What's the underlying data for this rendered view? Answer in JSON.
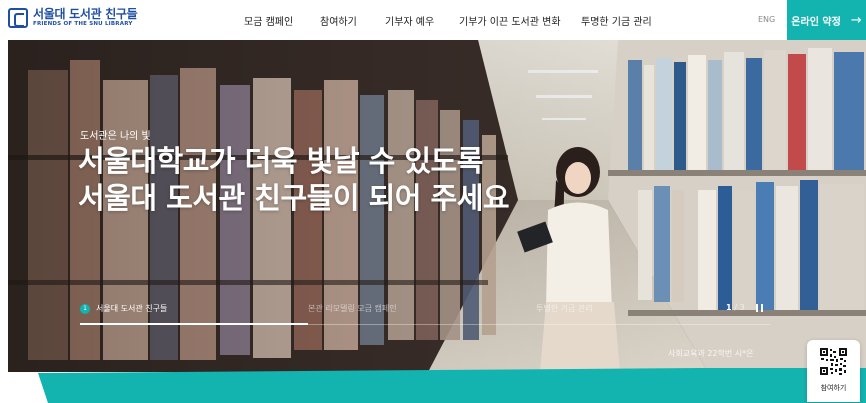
{
  "brand": {
    "title": "서울대 도서관 친구들",
    "subtitle": "FRIENDS OF THE SNU LIBRARY"
  },
  "nav": {
    "items": [
      "모금 캠페인",
      "참여하기",
      "기부자 예우",
      "기부가 이끈 도서관 변화",
      "투명한 기금 관리"
    ]
  },
  "header": {
    "lang": "ENG",
    "cta": "온라인 약정",
    "cta_arrow": "→"
  },
  "hero": {
    "eyebrow": "도서관은 나의 빛",
    "headline_line1": "서울대학교가 더욱 빛날 수 있도록",
    "headline_line2": "서울대 도서관 친구들이 되어 주세요",
    "caption": "사회교육과 22학번 시*은"
  },
  "slider": {
    "active_index": "1",
    "slides": [
      "서울대 도서관 친구들",
      "본관 리모델링 모금 캠페인",
      "투명한 기금 관리"
    ],
    "current": "1",
    "total": "/ 3",
    "progress": 0.33
  },
  "qr": {
    "label": "참여하기"
  },
  "colors": {
    "brand_blue": "#1f4fa3",
    "accent_teal": "#13b3b0"
  },
  "icons": [
    "logo-book-icon",
    "arrow-right-icon",
    "pause-icon",
    "qr-code-icon"
  ]
}
